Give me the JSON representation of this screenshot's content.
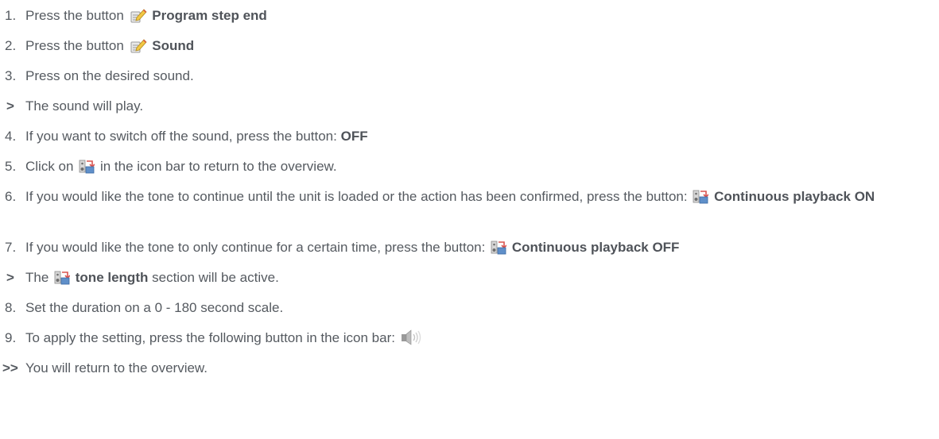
{
  "steps": [
    {
      "marker": "1.",
      "pre": "Press the button",
      "icon": "edit-note-icon",
      "bold": "Program step end",
      "post": ""
    },
    {
      "marker": "2.",
      "pre": "Press the button",
      "icon": "edit-note-icon",
      "bold": "Sound",
      "post": ""
    },
    {
      "marker": "3.",
      "pre": "Press on the desired sound.",
      "icon": "",
      "bold": "",
      "post": ""
    },
    {
      "marker": ">",
      "pre": "The sound will play.",
      "icon": "",
      "bold": "",
      "post": ""
    },
    {
      "marker": "4.",
      "pre": "If you want to switch off the sound, press the button:",
      "icon": "",
      "bold": "OFF",
      "post": ""
    },
    {
      "marker": "5.",
      "pre": "Click on",
      "icon": "sound-settings-icon",
      "bold": "",
      "post": "in the icon bar to return to the overview."
    },
    {
      "marker": "6.",
      "pre": "If you would like the tone to continue until the unit is loaded or the action has been confirmed, press the button:",
      "icon": "sound-settings-icon",
      "bold": "Continuous playback ON",
      "post": ""
    },
    {
      "marker": "7.",
      "pre": "If you would like the tone to only continue for a certain time, press the button:",
      "icon": "sound-settings-icon",
      "bold": "Continuous playback OFF",
      "post": ""
    },
    {
      "marker": ">",
      "pre": "The",
      "icon": "sound-settings-icon",
      "bold": "tone length",
      "post": "section will be active."
    },
    {
      "marker": "8.",
      "pre": "Set the duration on a 0 - 180 second scale.",
      "icon": "",
      "bold": "",
      "post": ""
    },
    {
      "marker": "9.",
      "pre": "To apply the setting, press the following button in the icon bar:",
      "icon": "speaker-volume-icon",
      "bold": "",
      "post": ""
    },
    {
      "marker": ">>",
      "pre": "You will return to the overview.",
      "icon": "",
      "bold": "",
      "post": ""
    }
  ]
}
